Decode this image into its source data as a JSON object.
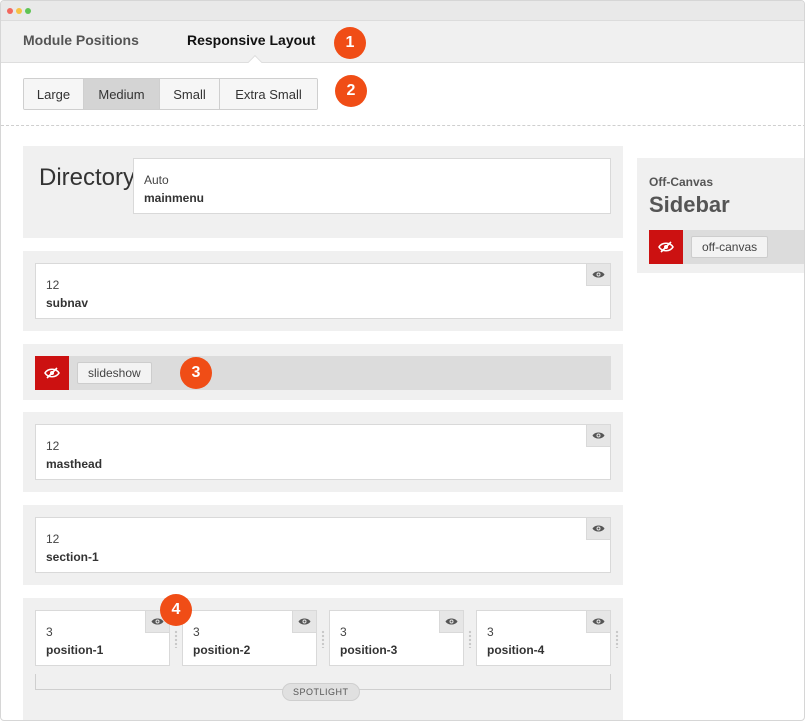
{
  "tabs": [
    {
      "label": "Module Positions",
      "active": false
    },
    {
      "label": "Responsive Layout",
      "active": true
    }
  ],
  "breakpoints": [
    {
      "label": "Large",
      "selected": false
    },
    {
      "label": "Medium",
      "selected": true
    },
    {
      "label": "Small",
      "selected": false
    },
    {
      "label": "Extra Small",
      "selected": false
    }
  ],
  "callouts": [
    "1",
    "2",
    "3",
    "4"
  ],
  "header_row": {
    "logo_text": "Directory",
    "menu_card": {
      "size": "Auto",
      "position": "mainmenu"
    }
  },
  "rows": [
    {
      "size": "12",
      "position": "subnav"
    },
    {
      "hidden_tag": "slideshow"
    },
    {
      "size": "12",
      "position": "masthead"
    },
    {
      "size": "12",
      "position": "section-1"
    }
  ],
  "spotlight": {
    "label": "SPOTLIGHT",
    "positions": [
      {
        "size": "3",
        "position": "position-1"
      },
      {
        "size": "3",
        "position": "position-2"
      },
      {
        "size": "3",
        "position": "position-3"
      },
      {
        "size": "3",
        "position": "position-4"
      }
    ]
  },
  "sidebar": {
    "subtitle": "Off-Canvas",
    "title": "Sidebar",
    "hidden_tag": "off-canvas"
  },
  "colors": {
    "callout": "#f04d16",
    "hidden_red": "#cc1111",
    "panel_bg": "#f0f0f0"
  },
  "icons": {
    "visibility": "eye-icon",
    "hidden": "eye-slash-icon"
  }
}
